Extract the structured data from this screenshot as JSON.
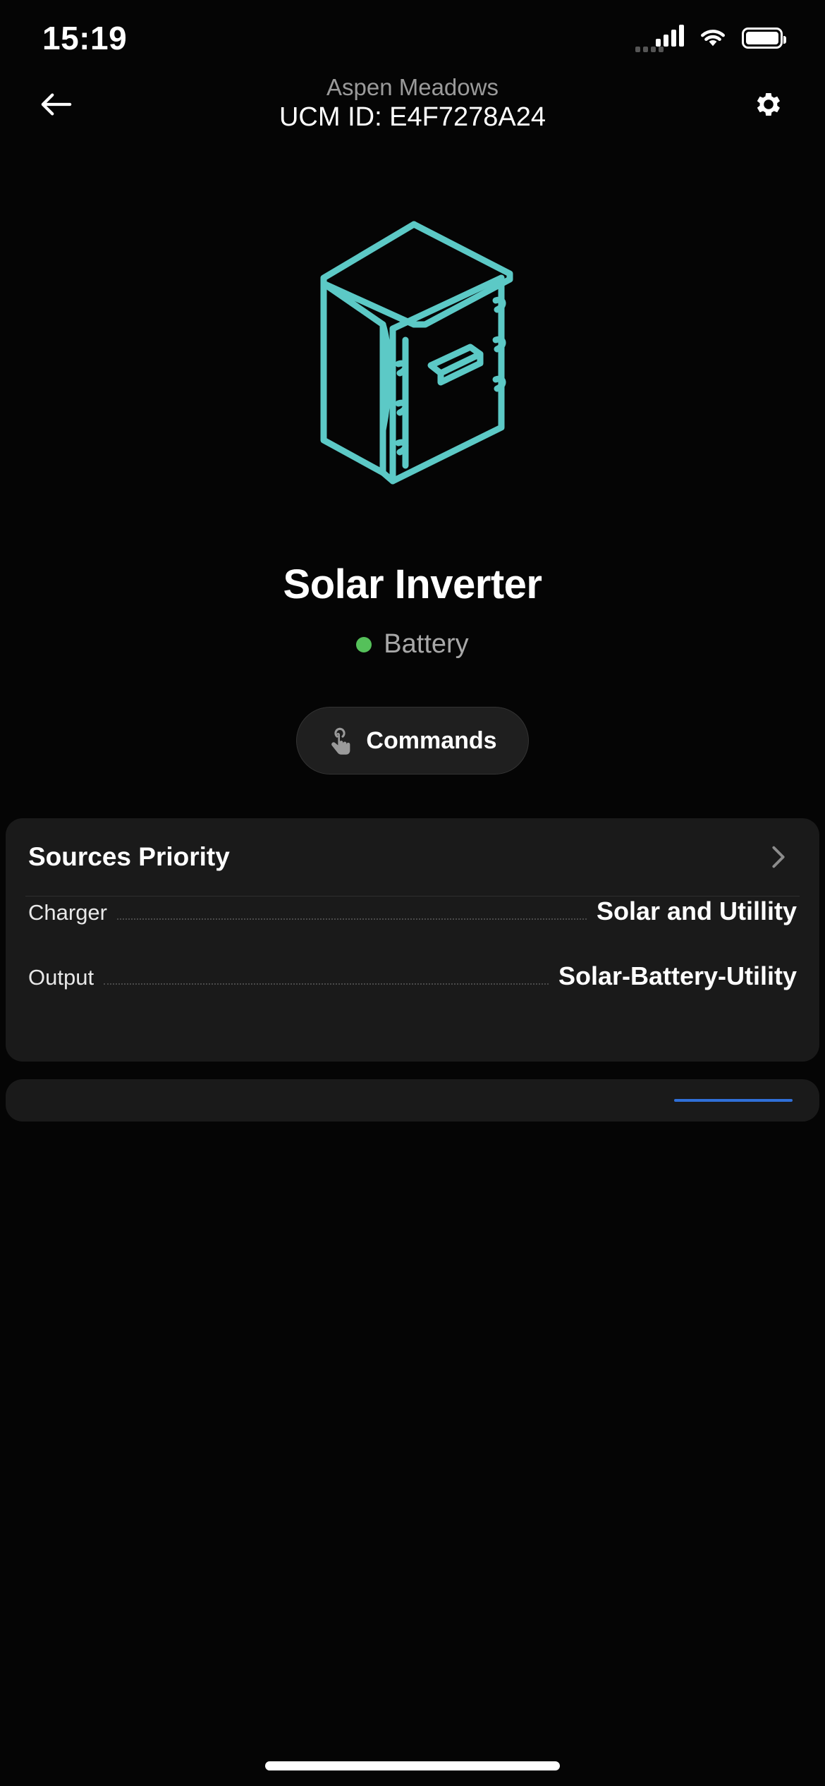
{
  "statusbar": {
    "time": "15:19",
    "signal_icon": "cellular-signal-icon",
    "wifi_icon": "wifi-icon",
    "battery_icon": "battery-full-icon"
  },
  "nav": {
    "back_icon": "back-arrow-icon",
    "site_name": "Aspen Meadows",
    "title": "UCM ID: E4F7278A24",
    "settings_icon": "gear-icon"
  },
  "hero": {
    "illustration_name": "solar-inverter-illustration",
    "accent_color": "#5cc9c6"
  },
  "device": {
    "name": "Solar Inverter",
    "status_label": "Battery",
    "status_color": "#55c15a"
  },
  "commands_button": {
    "label": "Commands",
    "icon": "tap-hand-icon"
  },
  "card": {
    "sources_priority": {
      "label": "Sources Priority",
      "chevron_icon": "chevron-right-icon"
    },
    "rows": [
      {
        "key": "Charger",
        "value": "Solar and Utillity"
      },
      {
        "key": "Output",
        "value": "Solar-Battery-Utility"
      }
    ]
  },
  "bottom": {
    "home_indicator": "home-indicator",
    "accent_strip_color": "#2f6fd8"
  }
}
